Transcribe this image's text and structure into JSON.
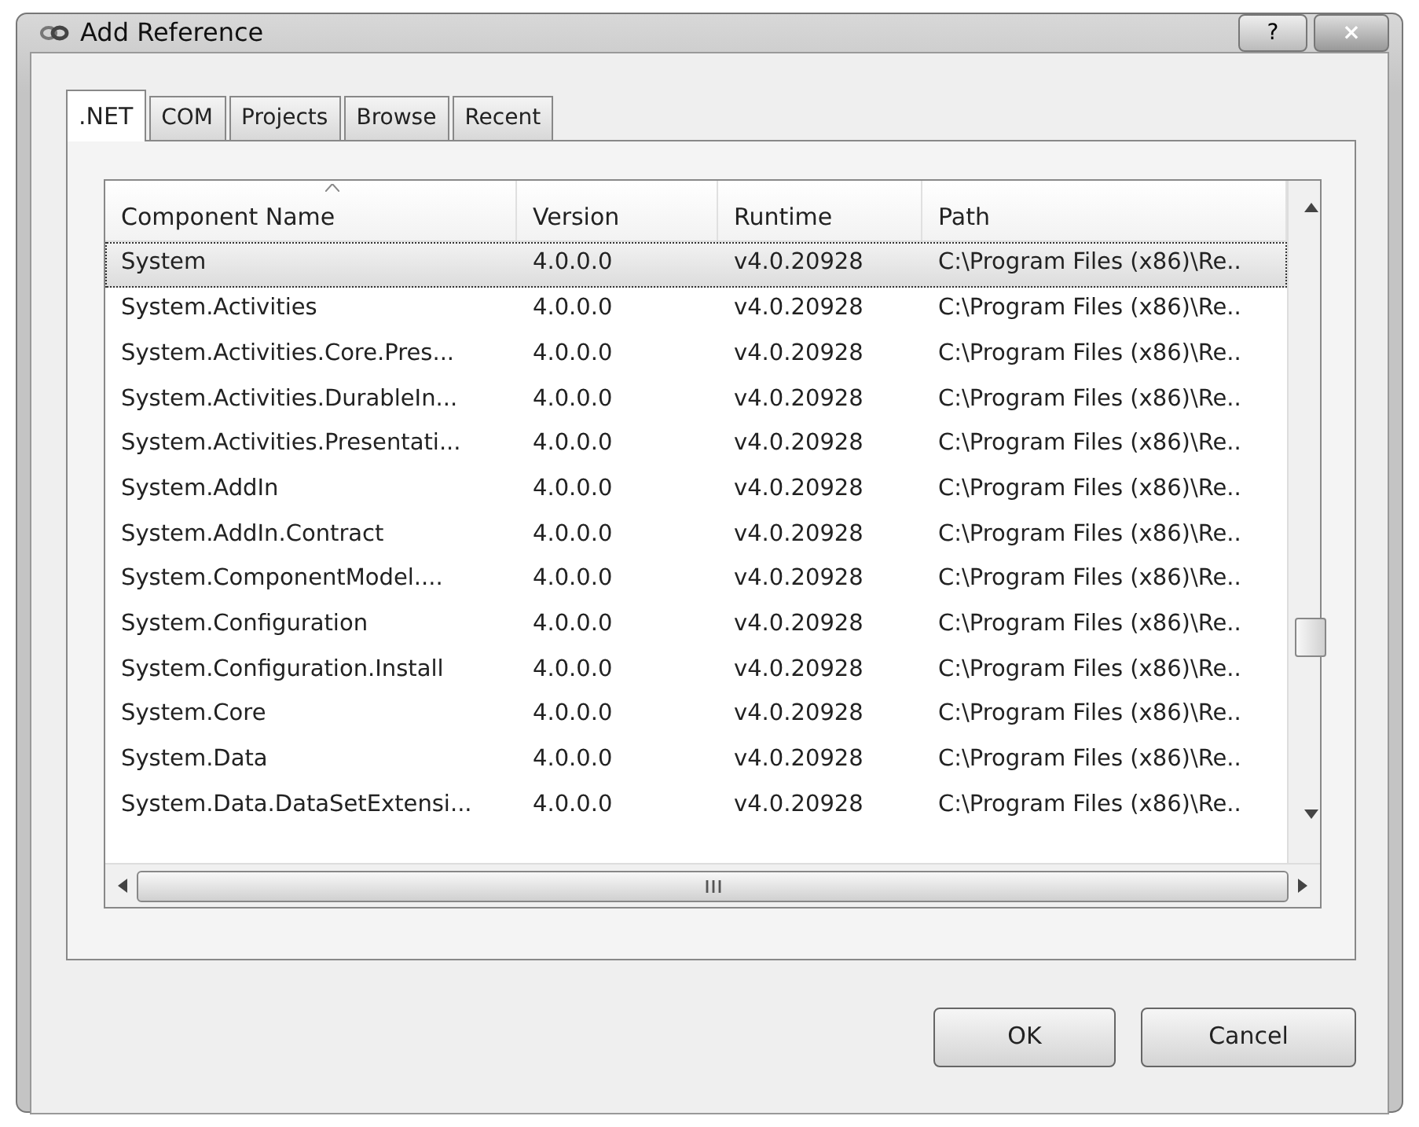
{
  "window": {
    "title": "Add Reference",
    "help_button": "?",
    "close_button": "×"
  },
  "tabs": [
    {
      "label": ".NET",
      "selected": true
    },
    {
      "label": "COM",
      "selected": false
    },
    {
      "label": "Projects",
      "selected": false
    },
    {
      "label": "Browse",
      "selected": false
    },
    {
      "label": "Recent",
      "selected": false
    }
  ],
  "table": {
    "columns": [
      "Component Name",
      "Version",
      "Runtime",
      "Path"
    ],
    "rows": [
      {
        "cells": [
          "System",
          "4.0.0.0",
          "v4.0.20928",
          "C:\\Program Files (x86)\\Re.."
        ],
        "selected": true
      },
      {
        "cells": [
          "System.Activities",
          "4.0.0.0",
          "v4.0.20928",
          "C:\\Program Files (x86)\\Re.."
        ],
        "selected": false
      },
      {
        "cells": [
          "System.Activities.Core.Pres...",
          "4.0.0.0",
          "v4.0.20928",
          "C:\\Program Files (x86)\\Re.."
        ],
        "selected": false
      },
      {
        "cells": [
          "System.Activities.DurableIn...",
          "4.0.0.0",
          "v4.0.20928",
          "C:\\Program Files (x86)\\Re.."
        ],
        "selected": false
      },
      {
        "cells": [
          "System.Activities.Presentati...",
          "4.0.0.0",
          "v4.0.20928",
          "C:\\Program Files (x86)\\Re.."
        ],
        "selected": false
      },
      {
        "cells": [
          "System.AddIn",
          "4.0.0.0",
          "v4.0.20928",
          "C:\\Program Files (x86)\\Re.."
        ],
        "selected": false
      },
      {
        "cells": [
          "System.AddIn.Contract",
          "4.0.0.0",
          "v4.0.20928",
          "C:\\Program Files (x86)\\Re.."
        ],
        "selected": false
      },
      {
        "cells": [
          "System.ComponentModel....",
          "4.0.0.0",
          "v4.0.20928",
          "C:\\Program Files (x86)\\Re.."
        ],
        "selected": false
      },
      {
        "cells": [
          "System.Configuration",
          "4.0.0.0",
          "v4.0.20928",
          "C:\\Program Files (x86)\\Re.."
        ],
        "selected": false
      },
      {
        "cells": [
          "System.Configuration.Install",
          "4.0.0.0",
          "v4.0.20928",
          "C:\\Program Files (x86)\\Re.."
        ],
        "selected": false
      },
      {
        "cells": [
          "System.Core",
          "4.0.0.0",
          "v4.0.20928",
          "C:\\Program Files (x86)\\Re.."
        ],
        "selected": false
      },
      {
        "cells": [
          "System.Data",
          "4.0.0.0",
          "v4.0.20928",
          "C:\\Program Files (x86)\\Re.."
        ],
        "selected": false
      },
      {
        "cells": [
          "System.Data.DataSetExtensi...",
          "4.0.0.0",
          "v4.0.20928",
          "C:\\Program Files (x86)\\Re.."
        ],
        "selected": false
      }
    ]
  },
  "buttons": [
    "OK",
    "Cancel"
  ]
}
